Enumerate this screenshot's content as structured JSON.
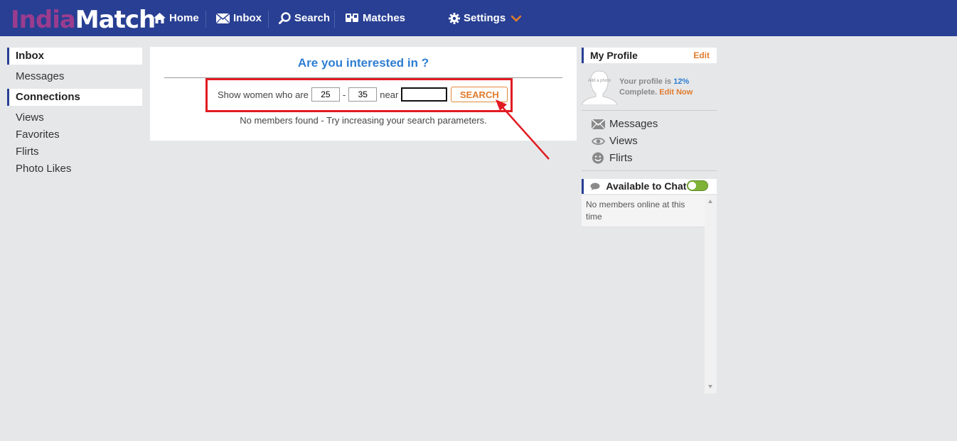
{
  "logo": {
    "part1": "India",
    "part2": "Match"
  },
  "nav": {
    "home": "Home",
    "inbox": "Inbox",
    "search": "Search",
    "matches": "Matches",
    "settings": "Settings"
  },
  "left_sidebar": {
    "inbox_heading": "Inbox",
    "messages": "Messages",
    "connections_heading": "Connections",
    "views": "Views",
    "favorites": "Favorites",
    "flirts": "Flirts",
    "photo_likes": "Photo Likes"
  },
  "main": {
    "title": "Are you interested in ?",
    "show_text": "Show women who are",
    "age_min": "25",
    "age_sep": "-",
    "age_max": "35",
    "near_text": "near",
    "near_value": "",
    "search_button": "SEARCH",
    "no_members": "No members found - Try increasing your search parameters."
  },
  "right_sidebar": {
    "profile_heading": "My Profile",
    "edit_label": "Edit",
    "avatar_text": "Add a photo",
    "profile_text_1": "Your profile is",
    "profile_pct": "12%",
    "profile_text_2": "Complete.",
    "edit_now": "Edit Now",
    "messages": "Messages",
    "views": "Views",
    "flirts": "Flirts",
    "chat_heading": "Available to Chat",
    "chat_toggle_on": true,
    "chat_empty": "No members online at this time"
  },
  "colors": {
    "navbar": "#283f93",
    "accent_blue": "#2e7ed2",
    "accent_orange": "#e07b2c",
    "annotation_red": "#e11b22",
    "toggle_green": "#7fb237"
  }
}
